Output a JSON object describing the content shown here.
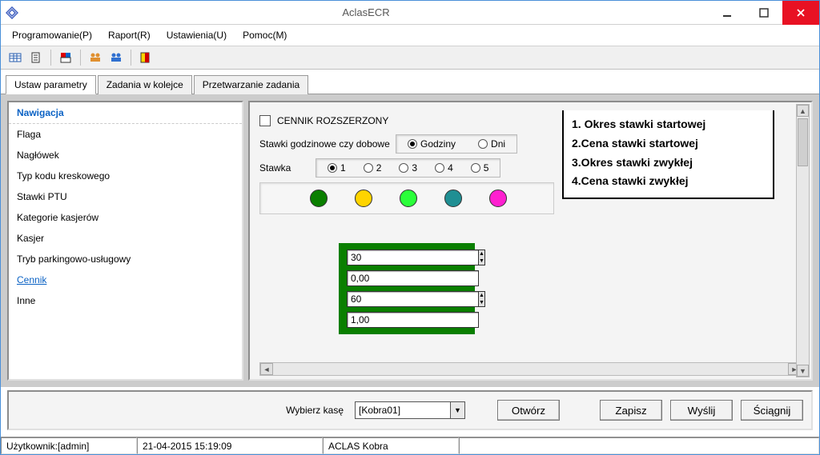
{
  "window": {
    "title": "AclasECR"
  },
  "menu": {
    "prog": "Programowanie(P)",
    "raport": "Raport(R)",
    "ustaw": "Ustawienia(U)",
    "pomoc": "Pomoc(M)"
  },
  "tabs": {
    "t0": "Ustaw parametry",
    "t1": "Zadania w kolejce",
    "t2": "Przetwarzanie zadania"
  },
  "nav": {
    "header": "Nawigacja",
    "i0": "Flaga",
    "i1": "Nagłówek",
    "i2": "Typ kodu kreskowego",
    "i3": "Stawki PTU",
    "i4": "Kategorie kasjerów",
    "i5": "Kasjer",
    "i6": "Tryb parkingowo-usługowy",
    "i7": "Cennik",
    "i8": "Inne"
  },
  "form": {
    "chk_label": "CENNIK ROZSZERZONY",
    "hourdaily_label": "Stawki godzinowe czy dobowe",
    "opt_hours": "Godziny",
    "opt_days": "Dni",
    "stawka_label": "Stawka",
    "r1": "1",
    "r2": "2",
    "r3": "3",
    "r4": "4",
    "r5": "5",
    "colors": {
      "c1": "#0a7f00",
      "c2": "#ffd400",
      "c3": "#2bff3a",
      "c4": "#1f8f93",
      "c5": "#ff1fd0"
    },
    "f1": "30",
    "f2": "0,00",
    "f3": "60",
    "f4": "1,00"
  },
  "legend": {
    "l1": "1. Okres stawki startowej",
    "l2": "2.Cena stawki startowej",
    "l3": "3.Okres stawki zwykłej",
    "l4": "4.Cena stawki zwykłej"
  },
  "bottom": {
    "pick_label": "Wybierz kasę",
    "select_val": "[Kobra01]",
    "open": "Otwórz",
    "save": "Zapisz",
    "send": "Wyślij",
    "get": "Ściągnij"
  },
  "status": {
    "user": "Użytkownik:[admin]",
    "datetime": "21-04-2015 15:19:09",
    "device": "ACLAS Kobra"
  }
}
